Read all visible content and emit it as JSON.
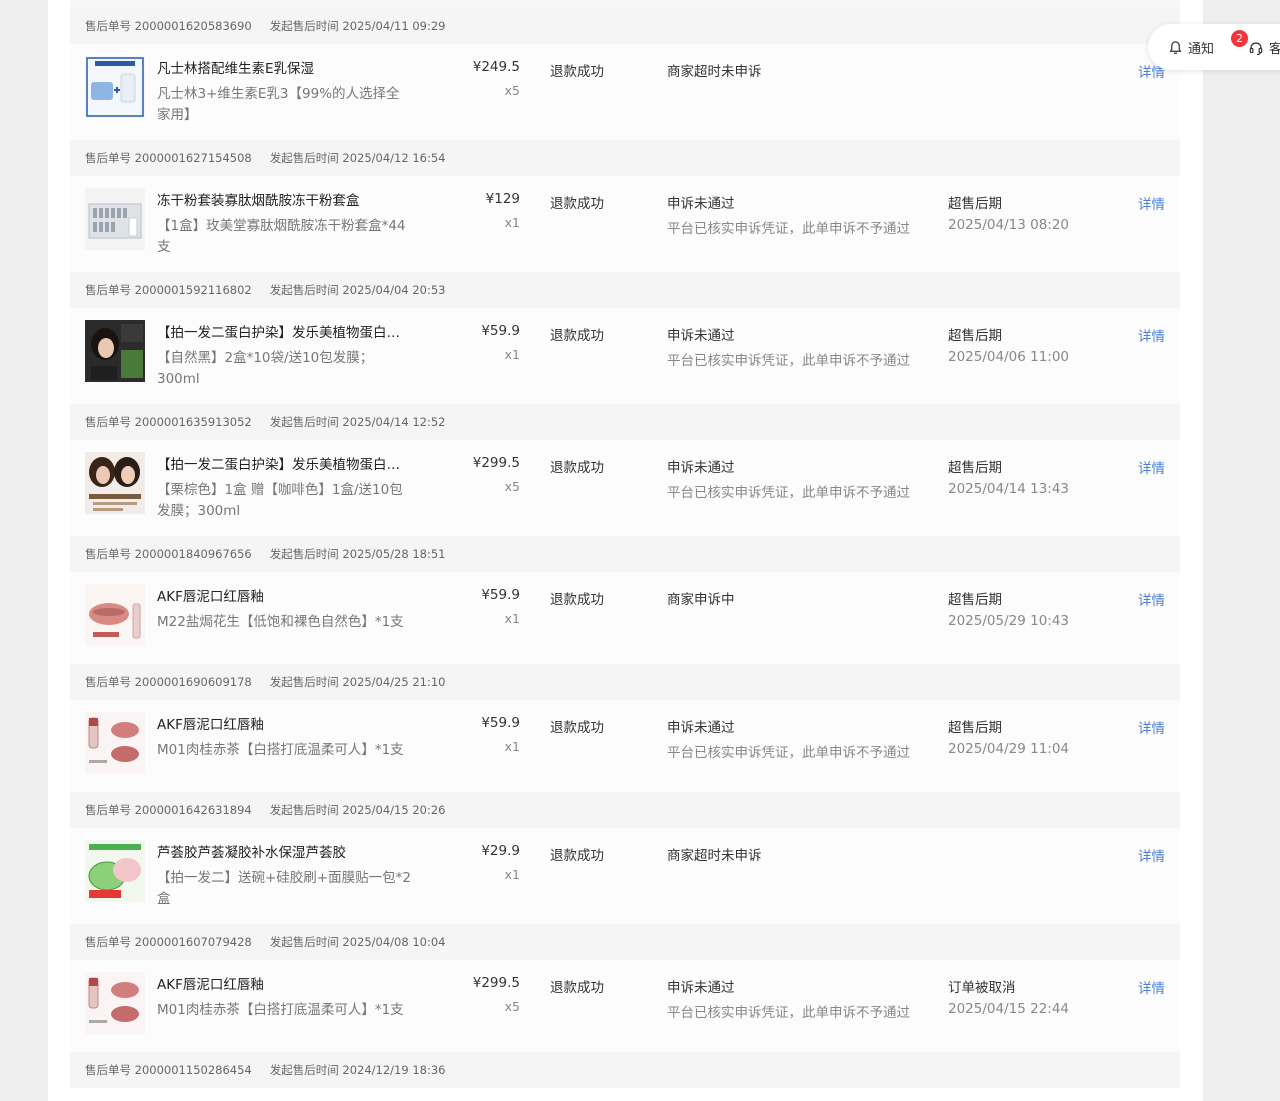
{
  "float_bar": {
    "notify_label": "通知",
    "notify_count": "2",
    "service_label": "客"
  },
  "detail_label": "详情",
  "labels": {
    "order_prefix": "售后单号",
    "time_prefix": "发起售后时间"
  },
  "groups": [
    {
      "order_no": "2000001620583690",
      "time": "2025/04/11 09:29",
      "name": "凡士林搭配维生素E乳保湿",
      "spec": "凡士林3+维生素E乳3【99%的人选择全家用】",
      "price": "¥249.5",
      "qty": "x5",
      "status": "退款成功",
      "appeal": "商家超时未申诉",
      "appeal_sub": "",
      "reason": "",
      "reason_time": ""
    },
    {
      "order_no": "2000001627154508",
      "time": "2025/04/12 16:54",
      "name": "冻干粉套装寡肽烟酰胺冻干粉套盒",
      "spec": "【1盒】玫美堂寡肽烟酰胺冻干粉套盒*44支",
      "price": "¥129",
      "qty": "x1",
      "status": "退款成功",
      "appeal": "申诉未通过",
      "appeal_sub": "平台已核实申诉凭证，此单申诉不予通过",
      "reason": "超售后期",
      "reason_time": "2025/04/13 08:20"
    },
    {
      "order_no": "2000001592116802",
      "time": "2025/04/04 20:53",
      "name": "【拍一发二蛋白护染】发乐美植物蛋白染...",
      "spec": "【自然黑】2盒*10袋/送10包发膜；300ml",
      "price": "¥59.9",
      "qty": "x1",
      "status": "退款成功",
      "appeal": "申诉未通过",
      "appeal_sub": "平台已核实申诉凭证，此单申诉不予通过",
      "reason": "超售后期",
      "reason_time": "2025/04/06 11:00"
    },
    {
      "order_no": "2000001635913052",
      "time": "2025/04/14 12:52",
      "name": "【拍一发二蛋白护染】发乐美植物蛋白染...",
      "spec": "【栗棕色】1盒 赠【咖啡色】1盒/送10包发膜；300ml",
      "price": "¥299.5",
      "qty": "x5",
      "status": "退款成功",
      "appeal": "申诉未通过",
      "appeal_sub": "平台已核实申诉凭证，此单申诉不予通过",
      "reason": "超售后期",
      "reason_time": "2025/04/14 13:43"
    },
    {
      "order_no": "2000001840967656",
      "time": "2025/05/28 18:51",
      "name": "AKF唇泥口红唇釉",
      "spec": "M22盐焗花生【低饱和裸色自然色】*1支",
      "price": "¥59.9",
      "qty": "x1",
      "status": "退款成功",
      "appeal": "商家申诉中",
      "appeal_sub": "",
      "reason": "超售后期",
      "reason_time": "2025/05/29 10:43"
    },
    {
      "order_no": "2000001690609178",
      "time": "2025/04/25 21:10",
      "name": "AKF唇泥口红唇釉",
      "spec": "M01肉桂赤茶【白搭打底温柔可人】*1支",
      "price": "¥59.9",
      "qty": "x1",
      "status": "退款成功",
      "appeal": "申诉未通过",
      "appeal_sub": "平台已核实申诉凭证，此单申诉不予通过",
      "reason": "超售后期",
      "reason_time": "2025/04/29 11:04"
    },
    {
      "order_no": "2000001642631894",
      "time": "2025/04/15 20:26",
      "name": "芦荟胶芦荟凝胶补水保湿芦荟胶",
      "spec": "【拍一发二】送碗+硅胶刷+面膜贴一包*2盒",
      "price": "¥29.9",
      "qty": "x1",
      "status": "退款成功",
      "appeal": "商家超时未申诉",
      "appeal_sub": "",
      "reason": "",
      "reason_time": ""
    },
    {
      "order_no": "2000001607079428",
      "time": "2025/04/08 10:04",
      "name": "AKF唇泥口红唇釉",
      "spec": "M01肉桂赤茶【白搭打底温柔可人】*1支",
      "price": "¥299.5",
      "qty": "x5",
      "status": "退款成功",
      "appeal": "申诉未通过",
      "appeal_sub": "平台已核实申诉凭证，此单申诉不予通过",
      "reason": "订单被取消",
      "reason_time": "2025/04/15 22:44"
    },
    {
      "order_no": "2000001150286454",
      "time": "2024/12/19 18:36"
    }
  ]
}
